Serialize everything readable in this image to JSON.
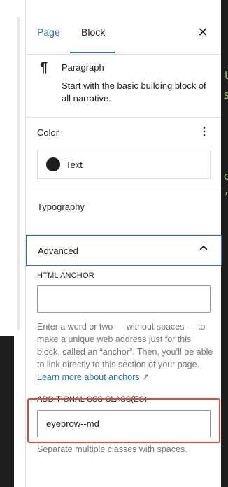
{
  "tabs": {
    "page": "Page",
    "block": "Block"
  },
  "close_glyph": "✕",
  "block": {
    "icon": "¶",
    "title": "Paragraph",
    "description": "Start with the basic building block of all narrative."
  },
  "color_panel": {
    "title": "Color",
    "menu_glyph": "⋮",
    "item_label": "Text",
    "swatch_color": "#1e1e1e"
  },
  "typography_panel": {
    "title": "Typography"
  },
  "advanced_panel": {
    "title": "Advanced",
    "html_anchor": {
      "label": "HTML ANCHOR",
      "value": "",
      "help_text": "Enter a word or two — without spaces — to make a unique web address just for this block, called an “anchor”. Then, you’ll be able to link directly to this section of your page.",
      "help_link": "Learn more about anchors",
      "link_glyph": "↗"
    },
    "css_classes": {
      "label": "ADDITIONAL CSS CLASS(ES)",
      "value": "eyebrow--md",
      "help_text": "Separate multiple classes with spaces."
    }
  },
  "editor_fragments": [
    "t",
    "s",
    "c",
    ","
  ],
  "colors": {
    "accent": "#2f6fb0",
    "highlight": "#e04a3a",
    "editor_bg": "#1e1e1e"
  }
}
